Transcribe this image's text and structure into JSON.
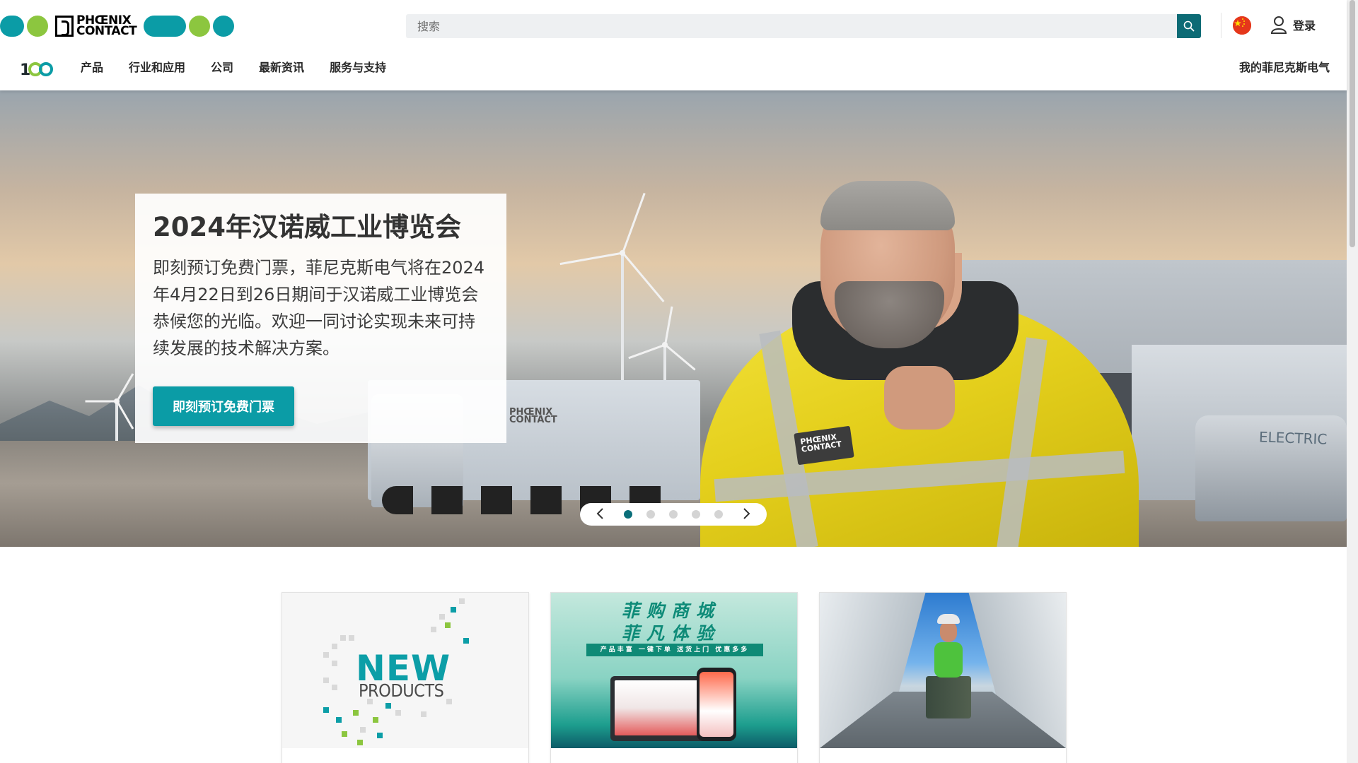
{
  "header": {
    "logo_text_line1": "PHŒNIX",
    "logo_text_line2": "CONTACT",
    "search_placeholder": "搜索",
    "login_label": "登录",
    "country": "China",
    "logo100": "100"
  },
  "nav": {
    "items": [
      {
        "label": "产品"
      },
      {
        "label": "行业和应用"
      },
      {
        "label": "公司"
      },
      {
        "label": "最新资讯"
      },
      {
        "label": "服务与支持"
      }
    ],
    "right_label": "我的菲尼克斯电气"
  },
  "hero": {
    "title": "2024年汉诺威工业博览会",
    "body": "即刻预订免费门票，菲尼克斯电气将在2024年4月22日到26日期间于汉诺威工业博览会恭候您的光临。欢迎一同讨论实现未来可持续发展的技术解决方案。",
    "button_label": "即刻预订免费门票",
    "truck_logo_line1": "PHŒNIX",
    "truck_logo_line2": "CONTACT",
    "truck_right_text": "ELECTRIC",
    "jacket_patch_line1": "PHŒNIX",
    "jacket_patch_line2": "CONTACT",
    "carousel": {
      "total_slides": 5,
      "active_index": 0,
      "prev_icon": "chevron-left-icon",
      "next_icon": "chevron-right-icon"
    }
  },
  "cards": [
    {
      "image_title": "NEW",
      "image_subtitle": "PRODUCTS"
    },
    {
      "image_title_line1": "菲购商城",
      "image_title_line2": "菲凡体验",
      "image_banner": "产品丰富  一键下单  送货上门  优惠多多"
    },
    {}
  ],
  "colors": {
    "brand_teal": "#0b9ca6",
    "brand_dark_teal": "#0c6b75",
    "brand_green": "#8cc63f",
    "carousel_active": "#0b6f7a"
  }
}
